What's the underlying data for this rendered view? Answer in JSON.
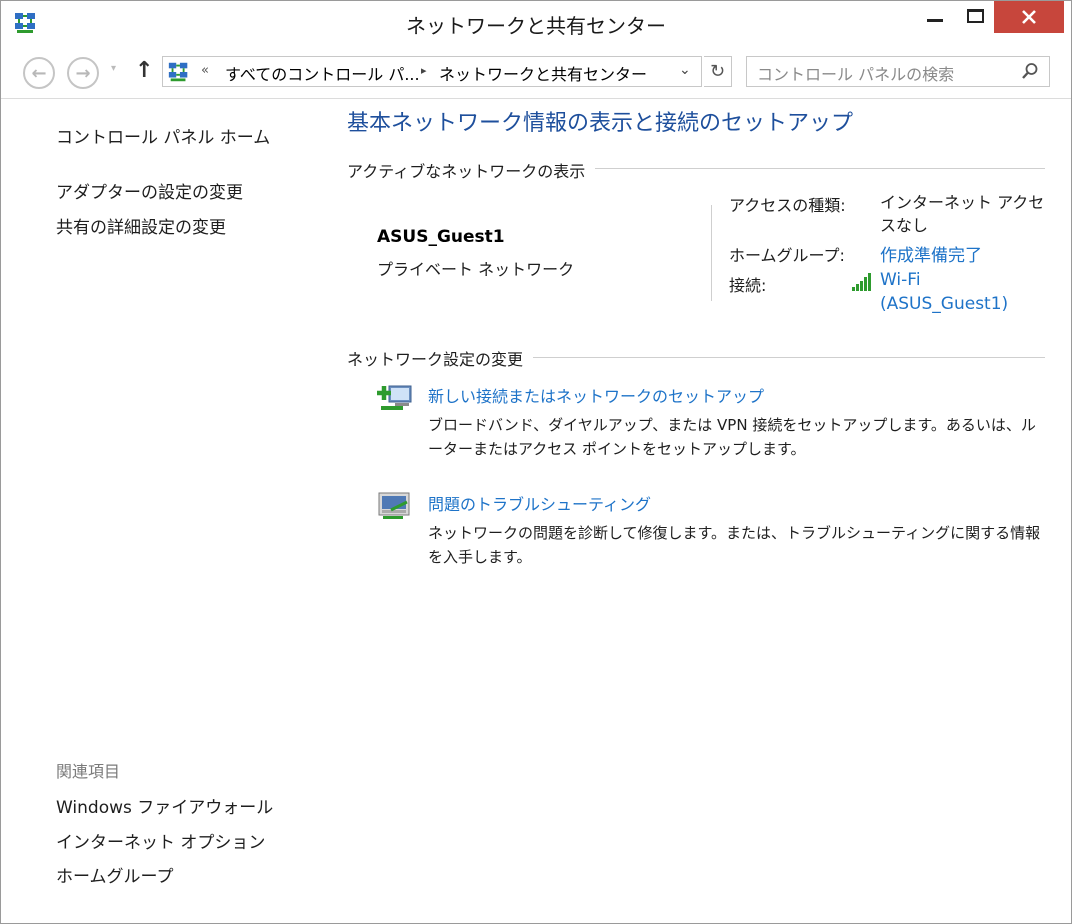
{
  "window": {
    "title": "ネットワークと共有センター"
  },
  "address_bar": {
    "overflow_chevron": "«",
    "crumb1": "すべてのコントロール パ...",
    "crumb_separator": "▸",
    "crumb2": "ネットワークと共有センター",
    "dropdown": "⌄",
    "refresh_glyph": "↻"
  },
  "search": {
    "placeholder": "コントロール パネルの検索"
  },
  "nav": {
    "back_glyph": "←",
    "forward_glyph": "→",
    "recent_glyph": "▾",
    "up_glyph": "↑"
  },
  "sidebar": {
    "home": "コントロール パネル ホーム",
    "links": [
      "アダプターの設定の変更",
      "共有の詳細設定の変更"
    ],
    "related_heading": "関連項目",
    "related": [
      "Windows ファイアウォール",
      "インターネット オプション",
      "ホームグループ"
    ]
  },
  "main": {
    "title": "基本ネットワーク情報の表示と接続のセットアップ",
    "active_section": "アクティブなネットワークの表示",
    "network": {
      "name": "ASUS_Guest1",
      "type": "プライベート ネットワーク"
    },
    "properties": {
      "access_label": "アクセスの種類:",
      "access_value": "インターネット アクセスなし",
      "homegroup_label": "ホームグループ:",
      "homegroup_value": "作成準備完了",
      "connection_label": "接続:",
      "connection_value_line1": "Wi-Fi",
      "connection_value_line2": "(ASUS_Guest1)"
    },
    "change_section": "ネットワーク設定の変更",
    "tasks": [
      {
        "title": "新しい接続またはネットワークのセットアップ",
        "description": "ブロードバンド、ダイヤルアップ、または VPN 接続をセットアップします。あるいは、ルーターまたはアクセス ポイントをセットアップします。",
        "icon": "new-connection-icon"
      },
      {
        "title": "問題のトラブルシューティング",
        "description": "ネットワークの問題を診断して修復します。または、トラブルシューティングに関する情報を入手します。",
        "icon": "troubleshoot-icon"
      }
    ]
  },
  "colors": {
    "link": "#1e73c8",
    "title": "#1e4f9c",
    "close_button": "#c7463c",
    "signal": "#2e9b2e"
  }
}
